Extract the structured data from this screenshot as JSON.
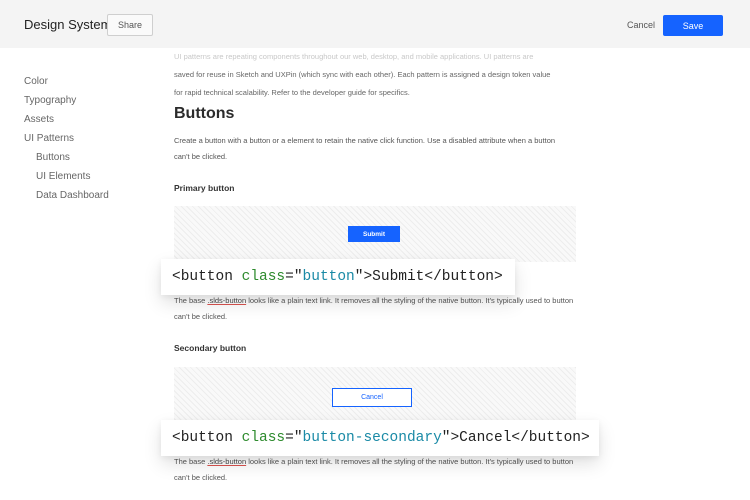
{
  "header": {
    "title": "Design System",
    "share_label": "Share",
    "cancel_label": "Cancel",
    "save_label": "Save"
  },
  "sidebar": {
    "items": [
      {
        "label": "Color"
      },
      {
        "label": "Typography"
      },
      {
        "label": "Assets"
      },
      {
        "label": "UI Patterns"
      },
      {
        "label": "Buttons"
      },
      {
        "label": "UI Elements"
      },
      {
        "label": "Data Dashboard"
      }
    ]
  },
  "main": {
    "intro_line1": "UI patterns are repeating components throughout our web, desktop, and mobile applications. UI patterns are",
    "intro_line2": "saved for reuse in Sketch and UXPin (which sync with each other). Each pattern is assigned a design token value",
    "intro_line3": "for rapid technical scalability. Refer to the developer guide for specifics.",
    "section_title": "Buttons",
    "section_desc": "Create a button with a button or a element to retain the native click function. Use a disabled attribute when a button can't be clicked.",
    "primary": {
      "title": "Primary button",
      "button_label": "Submit",
      "desc_prefix": "The base ",
      "desc_code": ".slds-button",
      "desc_suffix": " looks like a plain text link. It removes all the styling of the native button. It's typically used to button can't be clicked.",
      "code_open": "<button ",
      "code_attr": "class",
      "code_eq": "=\"",
      "code_val": "button",
      "code_close": "\">Submit</button>"
    },
    "secondary": {
      "title": "Secondary button",
      "button_label": "Cancel",
      "desc_prefix": "The base ",
      "desc_code": ".slds-button",
      "desc_suffix": " looks like a plain text link. It removes all the styling of the native button. It's typically used to button can't be clicked.",
      "code_open": "<button ",
      "code_attr": "class",
      "code_eq": "=\"",
      "code_val": "button-secondary",
      "code_close": "\">Cancel</button>"
    }
  }
}
